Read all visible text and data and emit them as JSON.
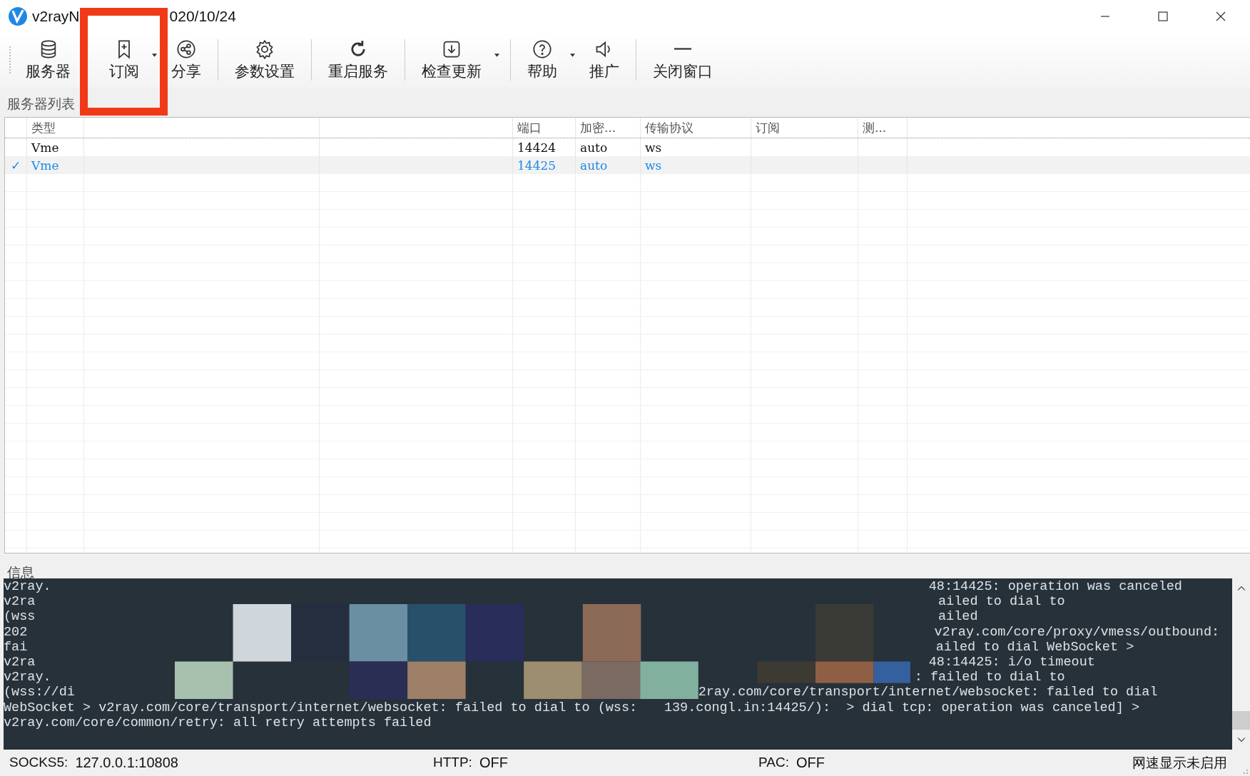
{
  "window": {
    "title_parts": [
      "v2rayN",
      "020/10/24"
    ]
  },
  "toolbar": [
    {
      "label": "服务器",
      "dropdown": false,
      "separator_after": false
    },
    {
      "label": "订阅",
      "dropdown": true,
      "separator_after": false
    },
    {
      "label": "分享",
      "dropdown": false,
      "separator_after": true
    },
    {
      "label": "参数设置",
      "dropdown": false,
      "separator_after": true
    },
    {
      "label": "重启服务",
      "dropdown": false,
      "separator_after": true
    },
    {
      "label": "检查更新",
      "dropdown": true,
      "separator_after": true
    },
    {
      "label": "帮助",
      "dropdown": true,
      "separator_after": false
    },
    {
      "label": "推广",
      "dropdown": false,
      "separator_after": true
    },
    {
      "label": "关闭窗口",
      "dropdown": false,
      "separator_after": false
    }
  ],
  "server_list": {
    "title": "服务器列表",
    "columns": [
      "类型",
      "端口",
      "加密...",
      "传输协议",
      "订阅",
      "测..."
    ],
    "rows": [
      {
        "type": "Vme",
        "port": "14424",
        "security": "auto",
        "network": "ws",
        "active": false,
        "selected": false
      },
      {
        "type": "Vme",
        "port": "14425",
        "security": "auto",
        "network": "ws",
        "active": true,
        "check": "✓",
        "selected": true
      }
    ]
  },
  "log": {
    "title": "信息",
    "lines": [
      {
        "segments": [
          "v2ray.",
          "48:14425: operation was canceled"
        ]
      },
      {
        "segments": [
          "v2ra",
          "ailed to dial to"
        ]
      },
      {
        "segments": [
          "(wss",
          "ailed"
        ]
      },
      {
        "segments": [
          "202",
          "v2ray.com/core/proxy/vmess/outbound:"
        ]
      },
      {
        "segments": [
          "fai",
          "ailed to dial WebSocket >"
        ]
      },
      {
        "segments": [
          "v2ra",
          "48:14425: i/o timeout"
        ]
      },
      {
        "segments": [
          "v2ray.",
          ": failed to dial to"
        ]
      },
      {
        "segments": [
          "(wss://di",
          "2ray.com/core/transport/internet/websocket: failed to dial"
        ]
      },
      {
        "segments": [
          "WebSocket > v2ray.com/core/transport/internet/websocket: failed to dial to (wss:",
          "139.congl.in:14425/):  > dial tcp: operation was canceled] >"
        ]
      },
      {
        "segments": [
          "v2ray.com/core/common/retry: all retry attempts failed"
        ]
      }
    ]
  },
  "status_bar": {
    "items": [
      {
        "label": "SOCKS5:",
        "value": "127.0.0.1:10808"
      },
      {
        "label": "HTTP:",
        "value": "OFF"
      },
      {
        "label": "PAC:",
        "value": "OFF"
      }
    ],
    "speed": "网速显示未启用"
  }
}
